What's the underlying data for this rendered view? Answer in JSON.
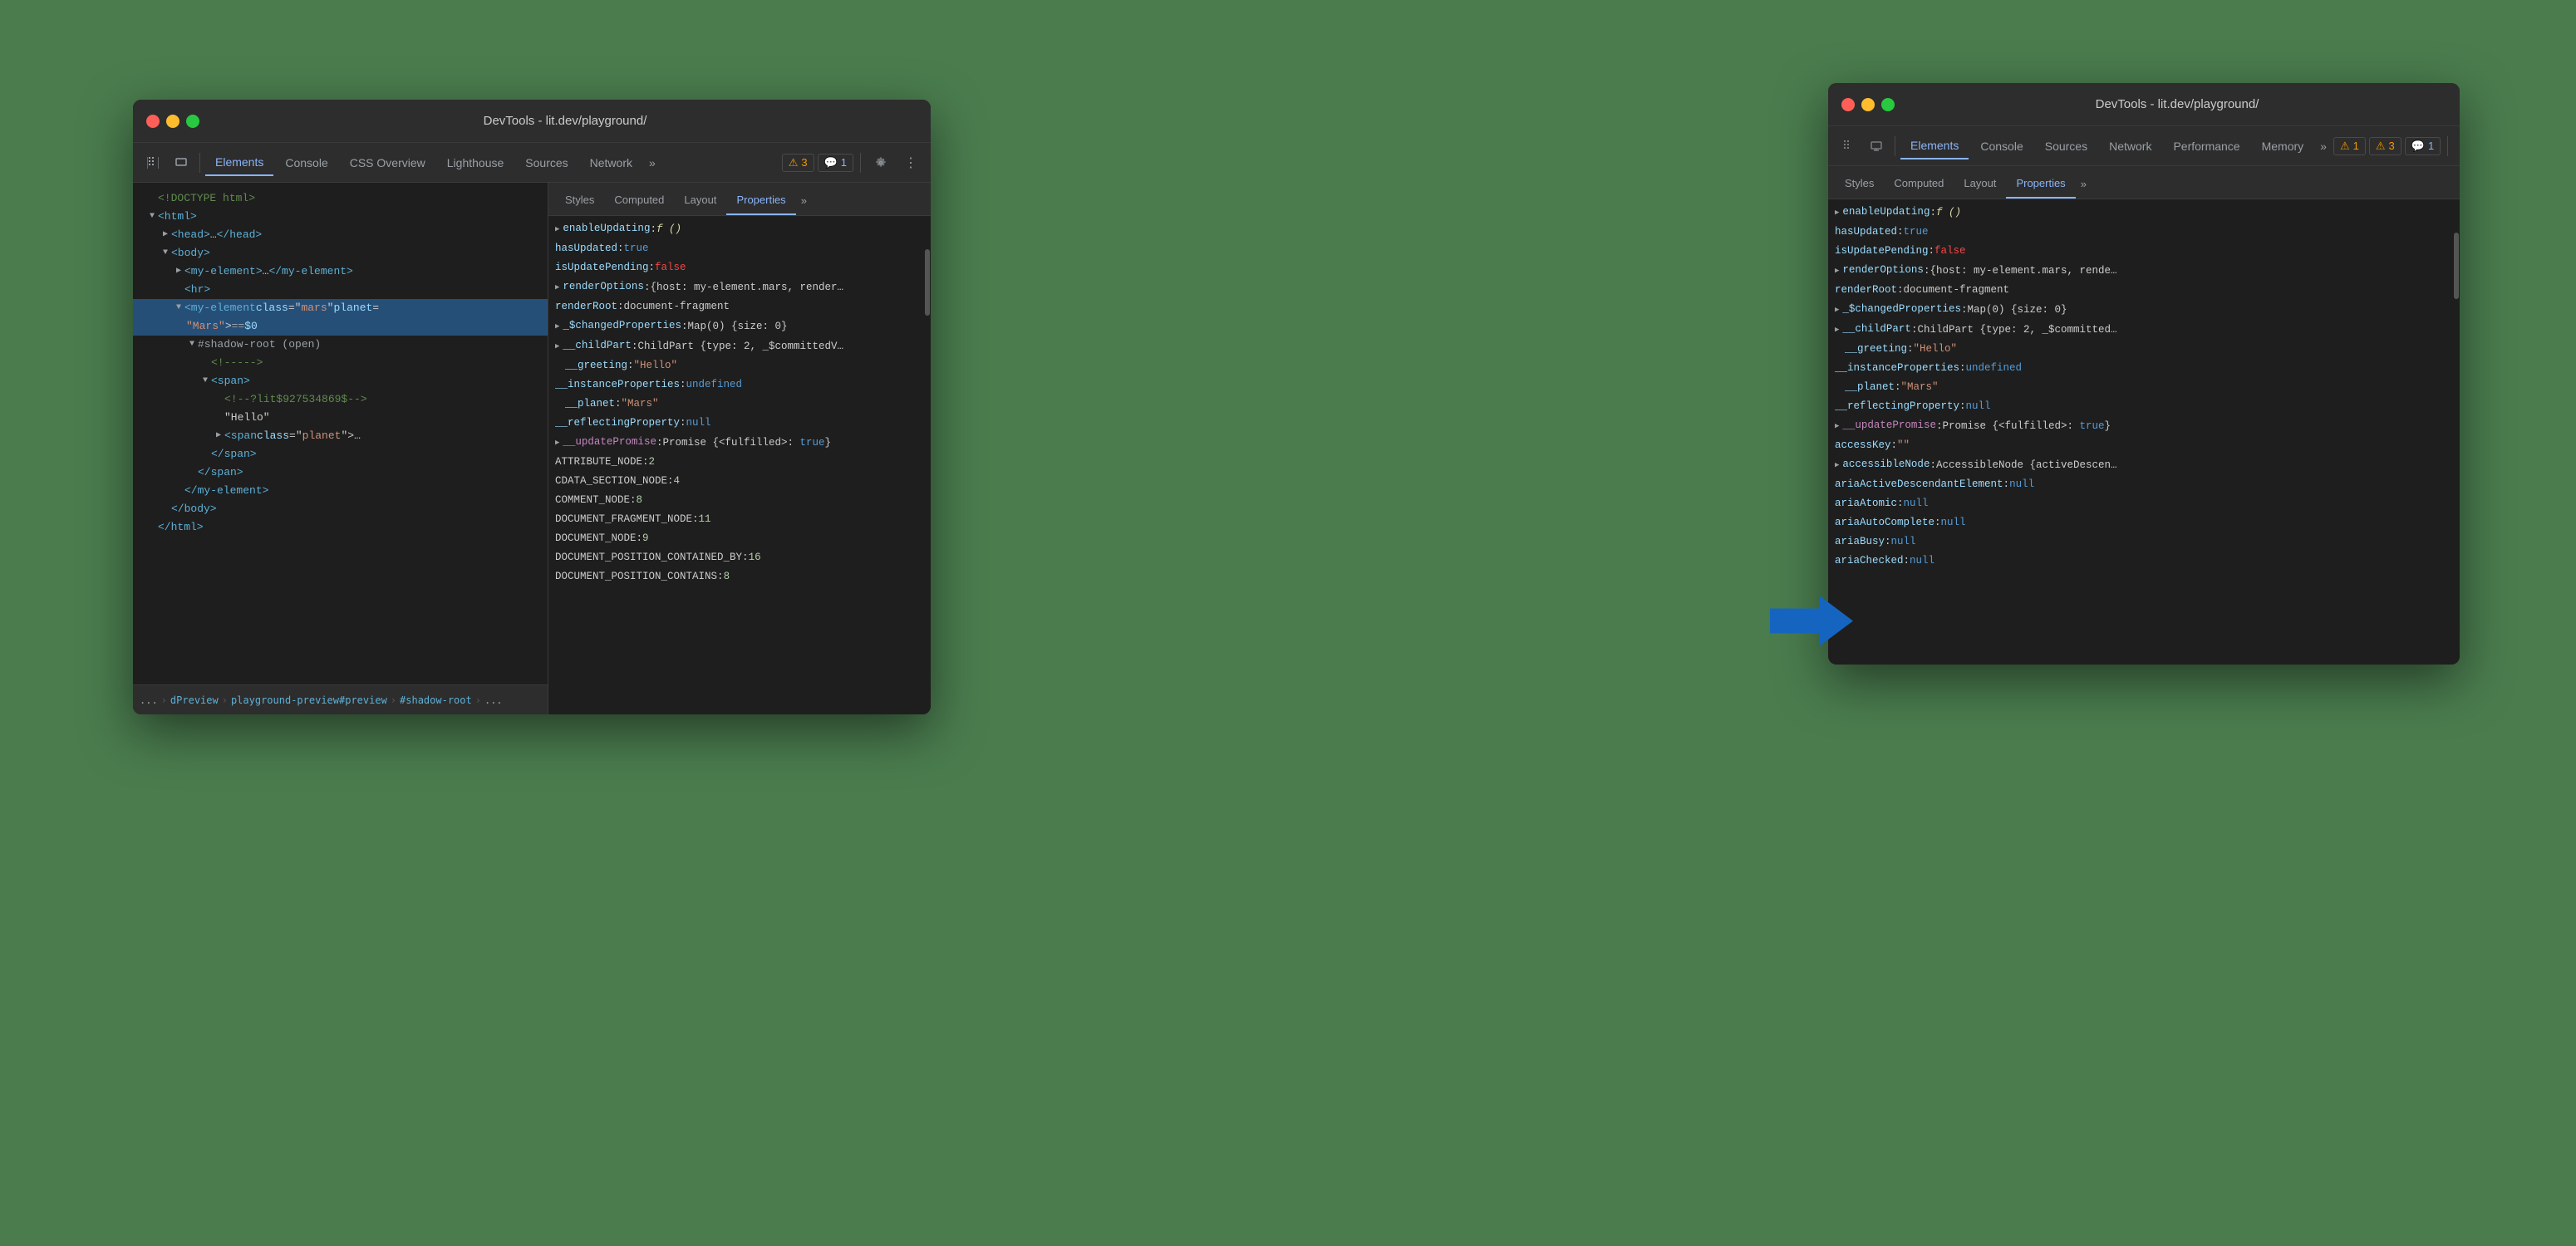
{
  "back_window": {
    "title": "DevTools - lit.dev/playground/",
    "toolbar": {
      "tabs": [
        "Elements",
        "Console",
        "CSS Overview",
        "Lighthouse",
        "Sources",
        "Network"
      ],
      "active_tab": "Elements",
      "overflow": "»",
      "badges": [
        {
          "type": "warning",
          "icon": "⚠",
          "count": "3"
        },
        {
          "type": "info",
          "icon": "💬",
          "count": "1"
        }
      ]
    },
    "dom": {
      "lines": [
        {
          "indent": 0,
          "content": "<!DOCTYPE html>",
          "type": "comment"
        },
        {
          "indent": 1,
          "content": "<html>",
          "type": "element"
        },
        {
          "indent": 2,
          "content": "<head>…</head>",
          "type": "element"
        },
        {
          "indent": 2,
          "content": "<body>",
          "type": "element"
        },
        {
          "indent": 3,
          "content": "<my-element>…</my-element>",
          "type": "element"
        },
        {
          "indent": 3,
          "content": "<hr>",
          "type": "element"
        },
        {
          "indent": 3,
          "content": "<my-element class=\"mars\" planet=",
          "type": "element-selected",
          "extra": "\"Mars\"> == $0"
        },
        {
          "indent": 4,
          "content": "#shadow-root (open)",
          "type": "shadow"
        },
        {
          "indent": 5,
          "content": "<!----->",
          "type": "comment"
        },
        {
          "indent": 5,
          "content": "<span>",
          "type": "element"
        },
        {
          "indent": 6,
          "content": "<!--?lit$927534869$-->",
          "type": "comment"
        },
        {
          "indent": 6,
          "content": "\"Hello\"",
          "type": "text"
        },
        {
          "indent": 6,
          "content": "<span class=\"planet\">…",
          "type": "element"
        },
        {
          "indent": 5,
          "content": "</span>",
          "type": "element"
        },
        {
          "indent": 4,
          "content": "</span>",
          "type": "element"
        },
        {
          "indent": 3,
          "content": "</my-element>",
          "type": "element"
        },
        {
          "indent": 2,
          "content": "</body>",
          "type": "element"
        },
        {
          "indent": 1,
          "content": "</html>",
          "type": "element"
        }
      ]
    },
    "breadcrumb": [
      "...",
      "dPreview",
      "playground-preview#preview",
      "#shadow-root",
      "..."
    ],
    "properties_panel": {
      "tabs": [
        "Styles",
        "Computed",
        "Layout",
        "Properties"
      ],
      "active_tab": "Properties",
      "overflow": "»",
      "properties": [
        {
          "key": "enableUpdating",
          "colon": ":",
          "value": "f ()",
          "type": "func",
          "expandable": false
        },
        {
          "key": "hasUpdated",
          "colon": ":",
          "value": "true",
          "type": "bool-true"
        },
        {
          "key": "isUpdatePending",
          "colon": ":",
          "value": "false",
          "type": "bool-false"
        },
        {
          "key": "renderOptions",
          "colon": ":",
          "value": "{host: my-element.mars, render…",
          "type": "obj",
          "expandable": true
        },
        {
          "key": "renderRoot",
          "colon": ":",
          "value": "document-fragment",
          "type": "obj"
        },
        {
          "key": "_$changedProperties",
          "colon": ":",
          "value": "Map(0) {size: 0}",
          "type": "obj",
          "expandable": true
        },
        {
          "key": "__childPart",
          "colon": ":",
          "value": "ChildPart {type: 2, _$committed…",
          "type": "obj",
          "expandable": true
        },
        {
          "key": "__greeting",
          "colon": ":",
          "value": "\"Hello\"",
          "type": "string"
        },
        {
          "key": "__instanceProperties",
          "colon": ":",
          "value": "undefined",
          "type": "null"
        },
        {
          "key": "__planet",
          "colon": ":",
          "value": "\"Mars\"",
          "type": "string"
        },
        {
          "key": "__reflectingProperty",
          "colon": ":",
          "value": "null",
          "type": "null"
        },
        {
          "key": "__updatePromise",
          "colon": ":",
          "value": "Promise {<fulfilled>: true}",
          "type": "obj",
          "expandable": true
        },
        {
          "key": "ATTRIBUTE_NODE",
          "colon": ":",
          "value": "2",
          "type": "number"
        },
        {
          "key": "CDATA_SECTION_NODE",
          "colon": ":",
          "value": "4",
          "type": "number"
        },
        {
          "key": "COMMENT_NODE",
          "colon": ":",
          "value": "8",
          "type": "number"
        },
        {
          "key": "DOCUMENT_FRAGMENT_NODE",
          "colon": ":",
          "value": "11",
          "type": "number"
        },
        {
          "key": "DOCUMENT_NODE",
          "colon": ":",
          "value": "9",
          "type": "number"
        },
        {
          "key": "DOCUMENT_POSITION_CONTAINED_BY",
          "colon": ":",
          "value": "16",
          "type": "number"
        },
        {
          "key": "DOCUMENT_POSITION_CONTAINS",
          "colon": ":",
          "value": "8",
          "type": "number"
        }
      ]
    }
  },
  "front_window": {
    "title": "DevTools - lit.dev/playground/",
    "toolbar": {
      "tabs": [
        "Elements",
        "Console",
        "Sources",
        "Network",
        "Performance",
        "Memory"
      ],
      "active_tab": "Elements",
      "overflow": "»",
      "badges": [
        {
          "type": "warning",
          "icon": "⚠",
          "count": "1"
        },
        {
          "type": "warning2",
          "icon": "⚠",
          "count": "3"
        },
        {
          "type": "info",
          "icon": "💬",
          "count": "1"
        }
      ]
    },
    "properties_panel": {
      "tabs": [
        "Styles",
        "Computed",
        "Layout",
        "Properties"
      ],
      "active_tab": "Properties",
      "overflow": "»",
      "properties": [
        {
          "key": "enableUpdating",
          "colon": ":",
          "value": "f ()",
          "type": "func",
          "expandable": false
        },
        {
          "key": "hasUpdated",
          "colon": ":",
          "value": "true",
          "type": "bool-true"
        },
        {
          "key": "isUpdatePending",
          "colon": ":",
          "value": "false",
          "type": "bool-false"
        },
        {
          "key": "renderOptions",
          "colon": ":",
          "value": "{host: my-element.mars, rende…",
          "type": "obj",
          "expandable": true
        },
        {
          "key": "renderRoot",
          "colon": ":",
          "value": "document-fragment",
          "type": "obj"
        },
        {
          "key": "_$changedProperties",
          "colon": ":",
          "value": "Map(0) {size: 0}",
          "type": "obj",
          "expandable": true
        },
        {
          "key": "__childPart",
          "colon": ":",
          "value": "ChildPart {type: 2, _$committed…",
          "type": "obj",
          "expandable": true
        },
        {
          "key": "__greeting",
          "colon": ":",
          "value": "\"Hello\"",
          "type": "string"
        },
        {
          "key": "__instanceProperties",
          "colon": ":",
          "value": "undefined",
          "type": "null"
        },
        {
          "key": "__planet",
          "colon": ":",
          "value": "\"Mars\"",
          "type": "string"
        },
        {
          "key": "__reflectingProperty",
          "colon": ":",
          "value": "null",
          "type": "null"
        },
        {
          "key": "__updatePromise",
          "colon": ":",
          "value": "Promise {<fulfilled>: true}",
          "type": "obj",
          "expandable": true
        },
        {
          "key": "accessKey",
          "colon": ":",
          "value": "\"\"",
          "type": "string"
        },
        {
          "key": "accessibleNode",
          "colon": ":",
          "value": "AccessibleNode {activeDescen…",
          "type": "obj",
          "expandable": true
        },
        {
          "key": "ariaActiveDescendantElement",
          "colon": ":",
          "value": "null",
          "type": "null"
        },
        {
          "key": "ariaAtomic",
          "colon": ":",
          "value": "null",
          "type": "null"
        },
        {
          "key": "ariaAutoComplete",
          "colon": ":",
          "value": "null",
          "type": "null"
        },
        {
          "key": "ariaBusy",
          "colon": ":",
          "value": "null",
          "type": "null"
        },
        {
          "key": "ariaChecked",
          "colon": ":",
          "value": "null",
          "type": "null"
        }
      ]
    }
  },
  "arrow": {
    "color": "#1565c0"
  }
}
